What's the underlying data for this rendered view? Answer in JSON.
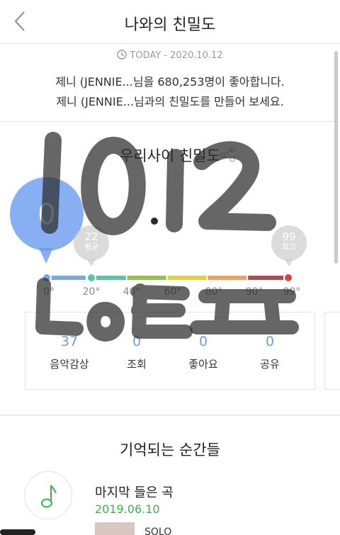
{
  "header": {
    "title": "나와의 친밀도"
  },
  "summary": {
    "today": "TODAY - 2020.10.12",
    "likes_line": "제니 (JENNIE...님을 680,253명이 좋아합니다.",
    "invite_line": "제니 (JENNIE...님과의 친밀도를 만들어 보세요."
  },
  "intimacy": {
    "title": "우리사이 친밀도",
    "score": "0",
    "average": {
      "value": "22",
      "label": "평균"
    },
    "max": {
      "value": "99",
      "label": "최고"
    },
    "scale_ticks": [
      "0°",
      "20°",
      "40°",
      "60°",
      "80°",
      "90°",
      "99°"
    ],
    "scale_colors": [
      "#7aa8e6",
      "#5cc4a0",
      "#8fc44a",
      "#e6cf3a",
      "#f0a060",
      "#b14a4a"
    ],
    "stats": [
      {
        "value": "37",
        "label": "음악감상"
      },
      {
        "value": "0",
        "label": "조회"
      },
      {
        "value": "0",
        "label": "좋아요"
      },
      {
        "value": "0",
        "label": "공유"
      }
    ]
  },
  "moments": {
    "title": "기억되는 순간들",
    "last_song_label": "마지막 들은 곡",
    "last_song_date": "2019.06.10",
    "song_title": "SOLO"
  },
  "handwriting": {
    "line1": "10.12",
    "line2": "LoVEㅍ"
  },
  "colors": {
    "accent_blue": "#6d9ce6",
    "accent_green": "#3cb34a"
  }
}
